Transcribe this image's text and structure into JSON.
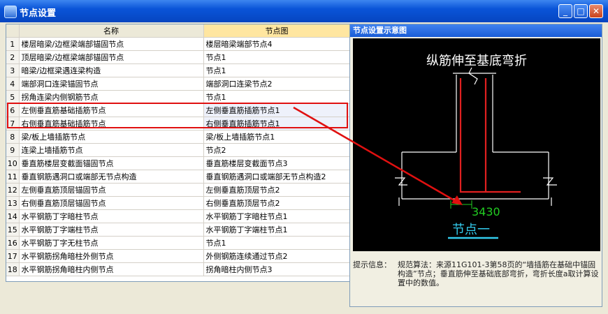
{
  "window": {
    "title": "节点设置",
    "min": "_",
    "max": "□",
    "close": "✕"
  },
  "table": {
    "headers": [
      "名称",
      "节点图"
    ],
    "rows": [
      {
        "n": "1",
        "name": "楼层暗梁/边框梁端部锚固节点",
        "pic": "楼层暗梁端部节点4"
      },
      {
        "n": "2",
        "name": "顶层暗梁/边框梁端部锚固节点",
        "pic": "节点1"
      },
      {
        "n": "3",
        "name": "暗梁/边框梁遇连梁构造",
        "pic": "节点1"
      },
      {
        "n": "4",
        "name": "端部洞口连梁锚固节点",
        "pic": "端部洞口连梁节点2"
      },
      {
        "n": "5",
        "name": "拐角连梁内侧钢筋节点",
        "pic": "节点1"
      },
      {
        "n": "6",
        "name": "左侧垂直筋基础插筋节点",
        "pic": "左侧垂直筋插筋节点1"
      },
      {
        "n": "7",
        "name": "右侧垂直筋基础插筋节点",
        "pic": "右侧垂直筋插筋节点1"
      },
      {
        "n": "8",
        "name": "梁/板上墙插筋节点",
        "pic": "梁/板上墙插筋节点1"
      },
      {
        "n": "9",
        "name": "连梁上墙插筋节点",
        "pic": "节点2"
      },
      {
        "n": "10",
        "name": "垂直筋楼层变截面锚固节点",
        "pic": "垂直筋楼层变截面节点3"
      },
      {
        "n": "11",
        "name": "垂直钢筋遇洞口或端部无节点构造",
        "pic": "垂直钢筋遇洞口或端部无节点构造2"
      },
      {
        "n": "12",
        "name": "左侧垂直筋顶层锚固节点",
        "pic": "左侧垂直筋顶层节点2"
      },
      {
        "n": "13",
        "name": "右侧垂直筋顶层锚固节点",
        "pic": "右侧垂直筋顶层节点2"
      },
      {
        "n": "14",
        "name": "水平钢筋丁字暗柱节点",
        "pic": "水平钢筋丁字暗柱节点1"
      },
      {
        "n": "15",
        "name": "水平钢筋丁字端柱节点",
        "pic": "水平钢筋丁字端柱节点1"
      },
      {
        "n": "16",
        "name": "水平钢筋丁字无柱节点",
        "pic": "节点1"
      },
      {
        "n": "17",
        "name": "水平钢筋拐角暗柱外侧节点",
        "pic": "外侧钢筋连续通过节点2"
      },
      {
        "n": "18",
        "name": "水平钢筋拐角暗柱内侧节点",
        "pic": "拐角暗柱内侧节点3"
      }
    ]
  },
  "panel": {
    "title": "节点设置示意图",
    "diagram_title": "纵筋伸至基底弯折",
    "dimension": "3430",
    "node_label": "节点一",
    "hint_label": "提示信息：",
    "hint_text": "规范算法：来源11G101-3第58页的“墙插筋在基础中锚固构造”节点；垂直筋伸至基础底部弯折，弯折长度a取计算设置中的数值。"
  },
  "colors": {
    "accent": "#0a54d8",
    "highlight": "#e01010",
    "header_pic": "#ffe6a0",
    "rebar": "#e02020",
    "dim": "#22cc22",
    "label": "#33ccee"
  }
}
